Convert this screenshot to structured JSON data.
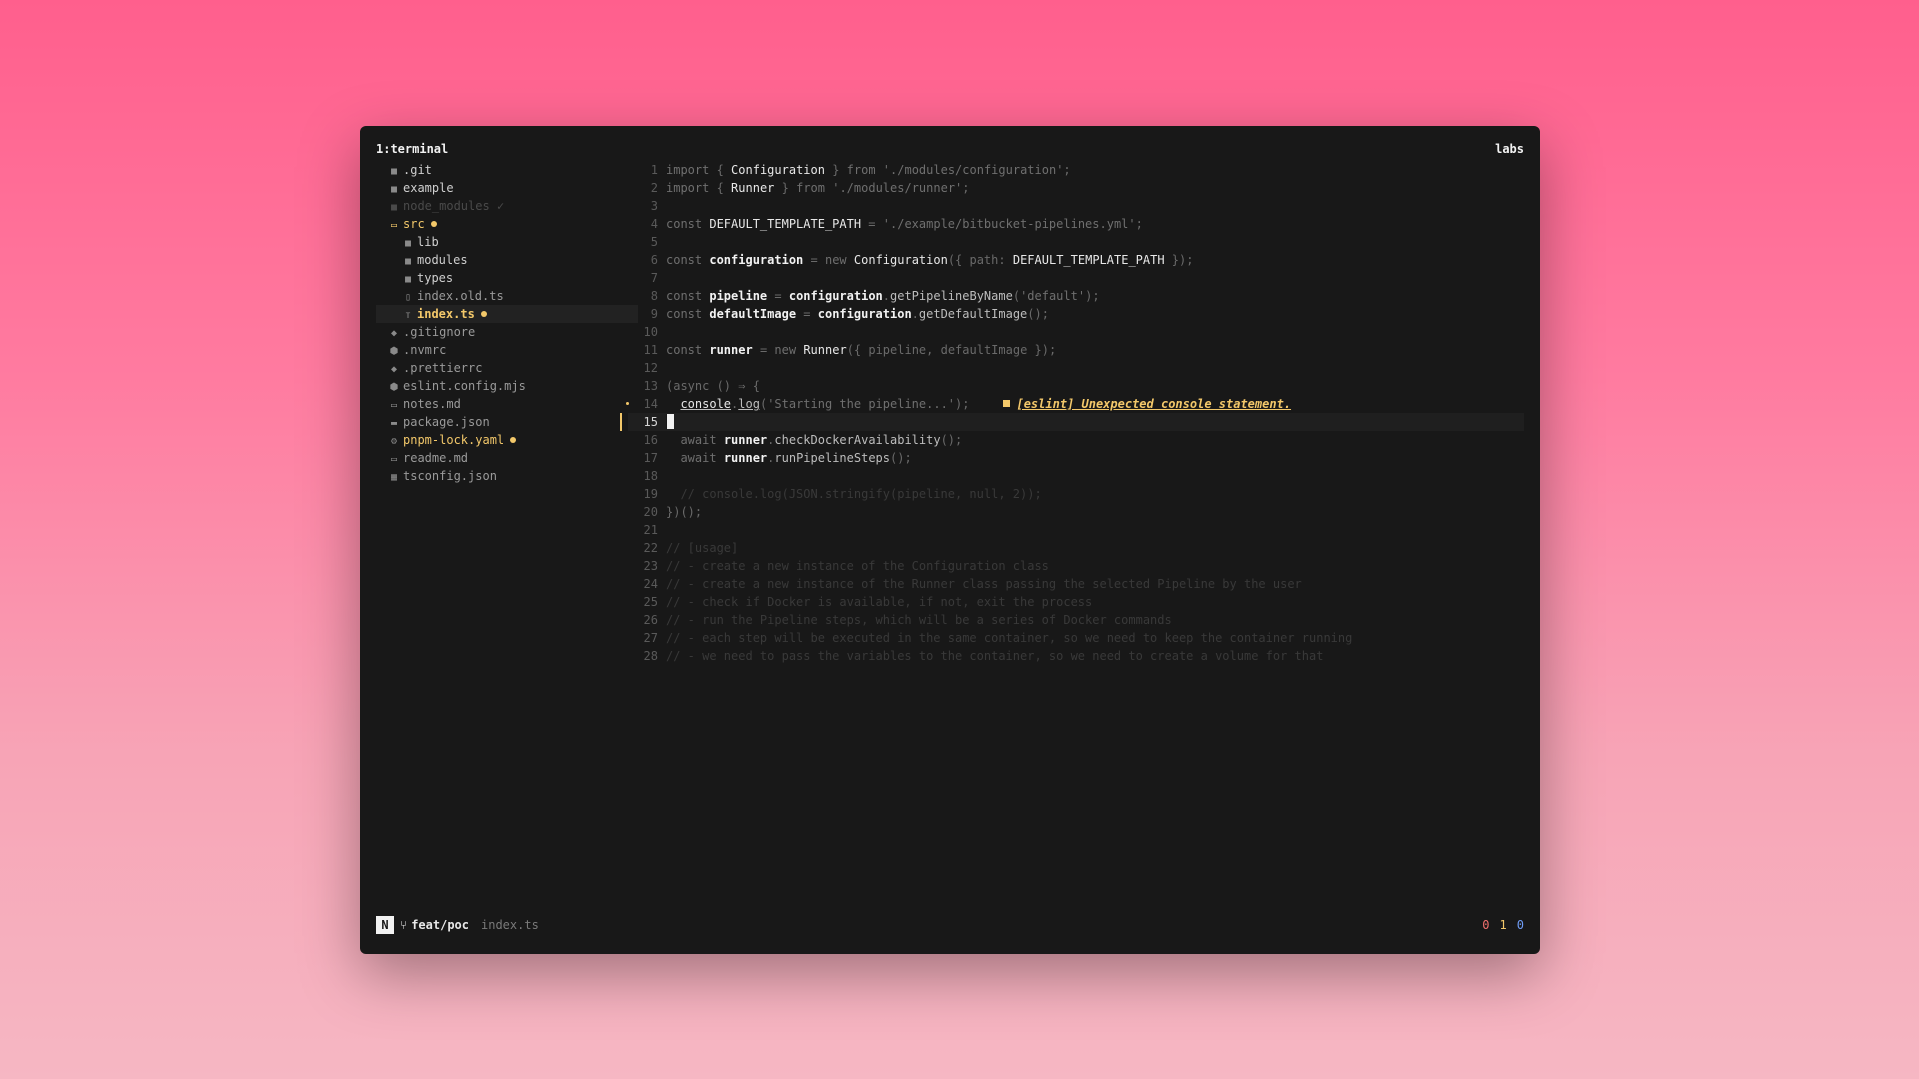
{
  "window": {
    "title": "1:terminal",
    "label_right": "labs"
  },
  "tree": {
    "items": [
      {
        "name": ".git",
        "icon": "folder-icon",
        "level": 0,
        "state": "normal"
      },
      {
        "name": "example",
        "icon": "folder-icon",
        "level": 0,
        "state": "normal"
      },
      {
        "name": "node_modules",
        "icon": "folder-icon",
        "level": 0,
        "state": "ignored",
        "badge": "✓"
      },
      {
        "name": "src",
        "icon": "folder-open-icon",
        "level": 0,
        "state": "modified"
      },
      {
        "name": "lib",
        "icon": "folder-icon",
        "level": 1,
        "state": "normal"
      },
      {
        "name": "modules",
        "icon": "folder-icon",
        "level": 1,
        "state": "normal"
      },
      {
        "name": "types",
        "icon": "folder-icon",
        "level": 1,
        "state": "normal"
      },
      {
        "name": "index.old.ts",
        "icon": "file-icon",
        "level": 1,
        "state": "muted"
      },
      {
        "name": "index.ts",
        "icon": "ts-file-icon",
        "level": 1,
        "state": "modified-selected"
      },
      {
        "name": ".gitignore",
        "icon": "git-icon",
        "level": 0,
        "state": "muted"
      },
      {
        "name": ".nvmrc",
        "icon": "node-icon",
        "level": 0,
        "state": "muted"
      },
      {
        "name": ".prettierrc",
        "icon": "prettier-icon",
        "level": 0,
        "state": "muted"
      },
      {
        "name": "eslint.config.mjs",
        "icon": "eslint-icon",
        "level": 0,
        "state": "muted"
      },
      {
        "name": "notes.md",
        "icon": "markdown-icon",
        "level": 0,
        "state": "muted"
      },
      {
        "name": "package.json",
        "icon": "npm-icon",
        "level": 0,
        "state": "muted"
      },
      {
        "name": "pnpm-lock.yaml",
        "icon": "gear-icon",
        "level": 0,
        "state": "modified"
      },
      {
        "name": "readme.md",
        "icon": "markdown-icon",
        "level": 0,
        "state": "muted"
      },
      {
        "name": "tsconfig.json",
        "icon": "tsconfig-icon",
        "level": 0,
        "state": "muted"
      }
    ]
  },
  "editor": {
    "current_line": 15,
    "diagnostic": "[eslint] Unexpected console statement.",
    "lines": [
      "1",
      "2",
      "3",
      "4",
      "5",
      "6",
      "7",
      "8",
      "9",
      "10",
      "11",
      "12",
      "13",
      "14",
      "15",
      "16",
      "17",
      "18",
      "19",
      "20",
      "21",
      "22",
      "23",
      "24",
      "25",
      "26",
      "27",
      "28"
    ]
  },
  "status": {
    "mode": "N",
    "branch": "feat/poc",
    "file": "index.ts",
    "errors": "0",
    "warnings": "1",
    "info": "0"
  }
}
